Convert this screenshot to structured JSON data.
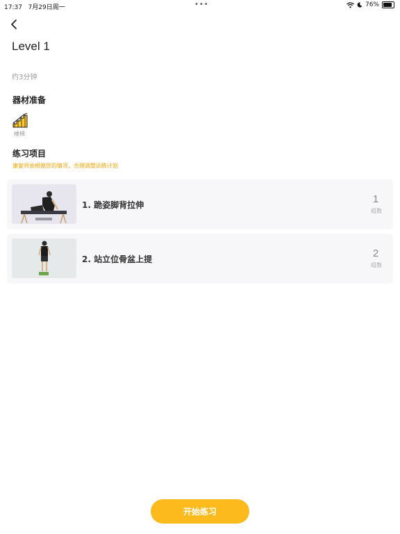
{
  "status_bar": {
    "time": "17:37",
    "date": "7月29日周一",
    "battery": "76%"
  },
  "header": {
    "title": "Level 1",
    "duration": "约3分钟"
  },
  "equipment": {
    "heading": "器材准备",
    "items": [
      {
        "label": "楼梯",
        "icon": "stairs-icon"
      }
    ]
  },
  "exercises": {
    "heading": "练习项目",
    "hint": "康复师会根据您的情况，合理调整训练计划",
    "items": [
      {
        "name": "1. 跪姿脚背拉伸",
        "count": "1",
        "unit": "组数"
      },
      {
        "name": "2. 站立位骨盆上提",
        "count": "2",
        "unit": "组数"
      }
    ]
  },
  "footer": {
    "start_label": "开始练习"
  },
  "colors": {
    "accent": "#FDBA1C",
    "hint": "#F5A300",
    "card_bg": "#F7F7F9"
  }
}
